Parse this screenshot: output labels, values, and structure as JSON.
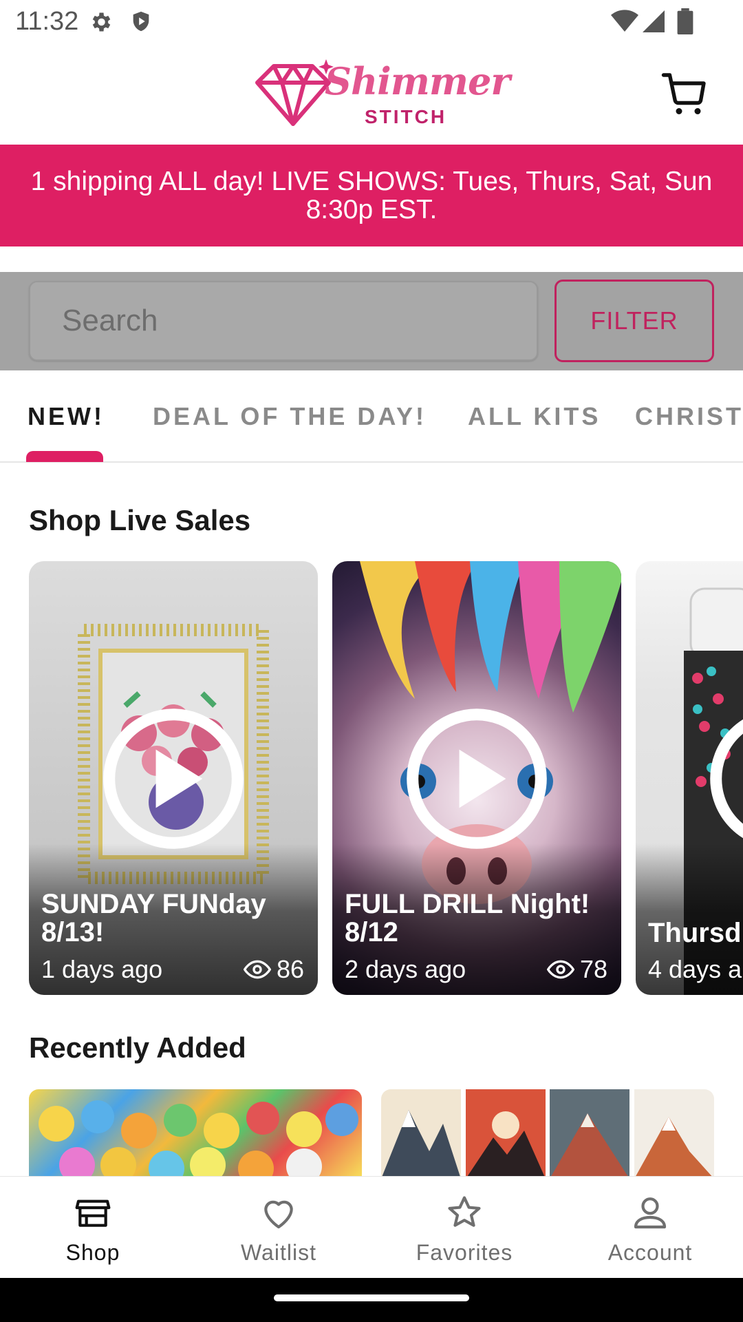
{
  "status_bar": {
    "time": "11:32"
  },
  "header": {
    "logo_text": "Shimmer",
    "logo_sub": "STITCH"
  },
  "banner": {
    "text": "1 shipping ALL day! LIVE SHOWS: Tues, Thurs, Sat, Sun 8:30p EST."
  },
  "search": {
    "placeholder": "Search",
    "filter_label": "FILTER"
  },
  "tabs": [
    {
      "label": "NEW!",
      "selected": true
    },
    {
      "label": "DEAL OF THE DAY!",
      "selected": false
    },
    {
      "label": "ALL KITS",
      "selected": false
    },
    {
      "label": "CHRISTI",
      "selected": false
    }
  ],
  "live_sales": {
    "title": "Shop Live Sales",
    "cards": [
      {
        "title": "SUNDAY FUNday 8/13!",
        "ago": "1 days ago",
        "views": "86"
      },
      {
        "title": "FULL DRILL Night! 8/12",
        "ago": "2 days ago",
        "views": "78"
      },
      {
        "title": "Thursd",
        "ago": "4 days a",
        "views": ""
      }
    ]
  },
  "recently_added": {
    "title": "Recently Added"
  },
  "bottom_nav": [
    {
      "label": "Shop",
      "icon": "store-icon",
      "selected": true
    },
    {
      "label": "Waitlist",
      "icon": "heart-icon",
      "selected": false
    },
    {
      "label": "Favorites",
      "icon": "star-icon",
      "selected": false
    },
    {
      "label": "Account",
      "icon": "person-icon",
      "selected": false
    }
  ],
  "colors": {
    "brand_pink": "#de1f63",
    "filter_border": "#c0225e"
  }
}
